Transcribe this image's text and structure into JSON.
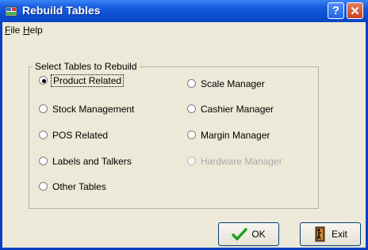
{
  "window": {
    "title": "Rebuild Tables"
  },
  "menu": [
    {
      "label": "File",
      "underline": "F",
      "rest": "ile"
    },
    {
      "label": "Help",
      "underline": "H",
      "rest": "elp"
    }
  ],
  "group": {
    "legend": "Select Tables to Rebuild",
    "options": [
      {
        "label": "Product Related",
        "selected": true,
        "disabled": false
      },
      {
        "label": "Stock Management",
        "selected": false,
        "disabled": false
      },
      {
        "label": "POS Related",
        "selected": false,
        "disabled": false
      },
      {
        "label": "Labels and Talkers",
        "selected": false,
        "disabled": false
      },
      {
        "label": "Other Tables",
        "selected": false,
        "disabled": false
      },
      {
        "label": "Scale Manager",
        "selected": false,
        "disabled": false
      },
      {
        "label": "Cashier Manager",
        "selected": false,
        "disabled": false
      },
      {
        "label": "Margin Manager",
        "selected": false,
        "disabled": false
      },
      {
        "label": "Hardware Manager",
        "selected": false,
        "disabled": true
      }
    ]
  },
  "buttons": {
    "ok": "OK",
    "exit": "Exit"
  },
  "icons": {
    "ok": "checkmark-icon",
    "exit": "door-exit-icon"
  },
  "colors": {
    "titlebar": "#0a4fd2",
    "face": "#ece9d8",
    "check": "#1e9e1e"
  }
}
